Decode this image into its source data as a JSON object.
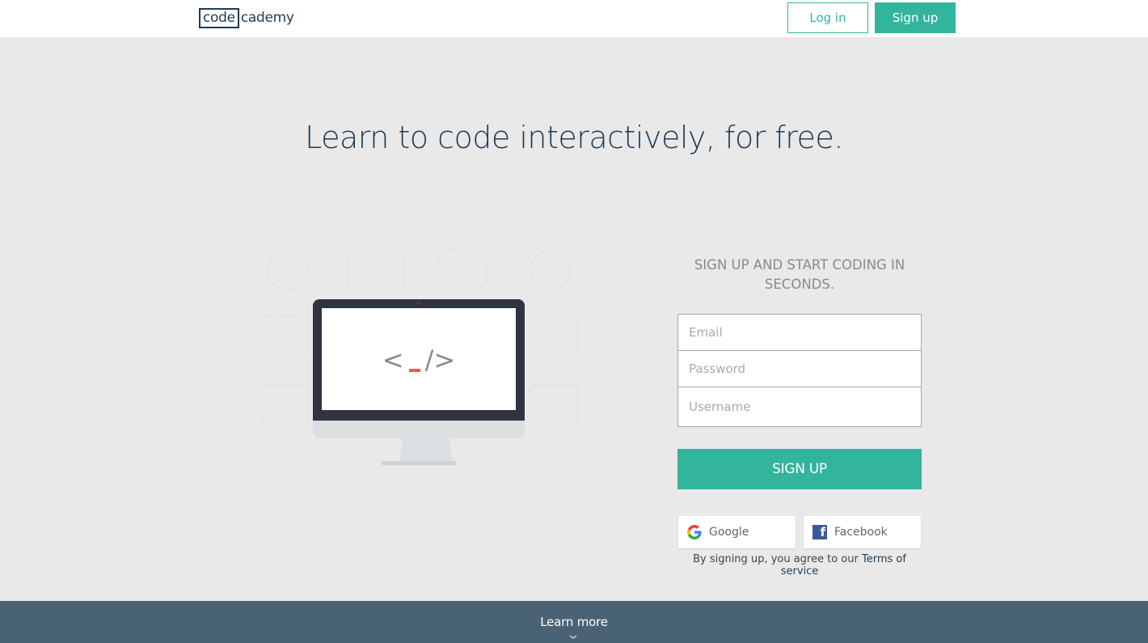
{
  "header": {
    "logo_box": "code",
    "logo_rest": "cademy",
    "login_label": "Log in",
    "signup_label": "Sign up"
  },
  "hero": {
    "title": "Learn to code interactively, for free."
  },
  "illustration": {
    "code_left": "<",
    "code_right": "/>"
  },
  "signup_form": {
    "heading": "SIGN UP AND START CODING IN SECONDS.",
    "email_placeholder": "Email",
    "password_placeholder": "Password",
    "username_placeholder": "Username",
    "submit_label": "SIGN UP",
    "google_label": "Google",
    "facebook_label": "Facebook",
    "terms_prefix": "By signing up, you agree to our ",
    "terms_link": "Terms of service"
  },
  "footer": {
    "learn_more_label": "Learn more"
  },
  "colors": {
    "brand_teal": "#33b49d",
    "navy": "#1f3a52",
    "footer_bg": "#4a6374",
    "cursor_red": "#ef5a4f"
  }
}
